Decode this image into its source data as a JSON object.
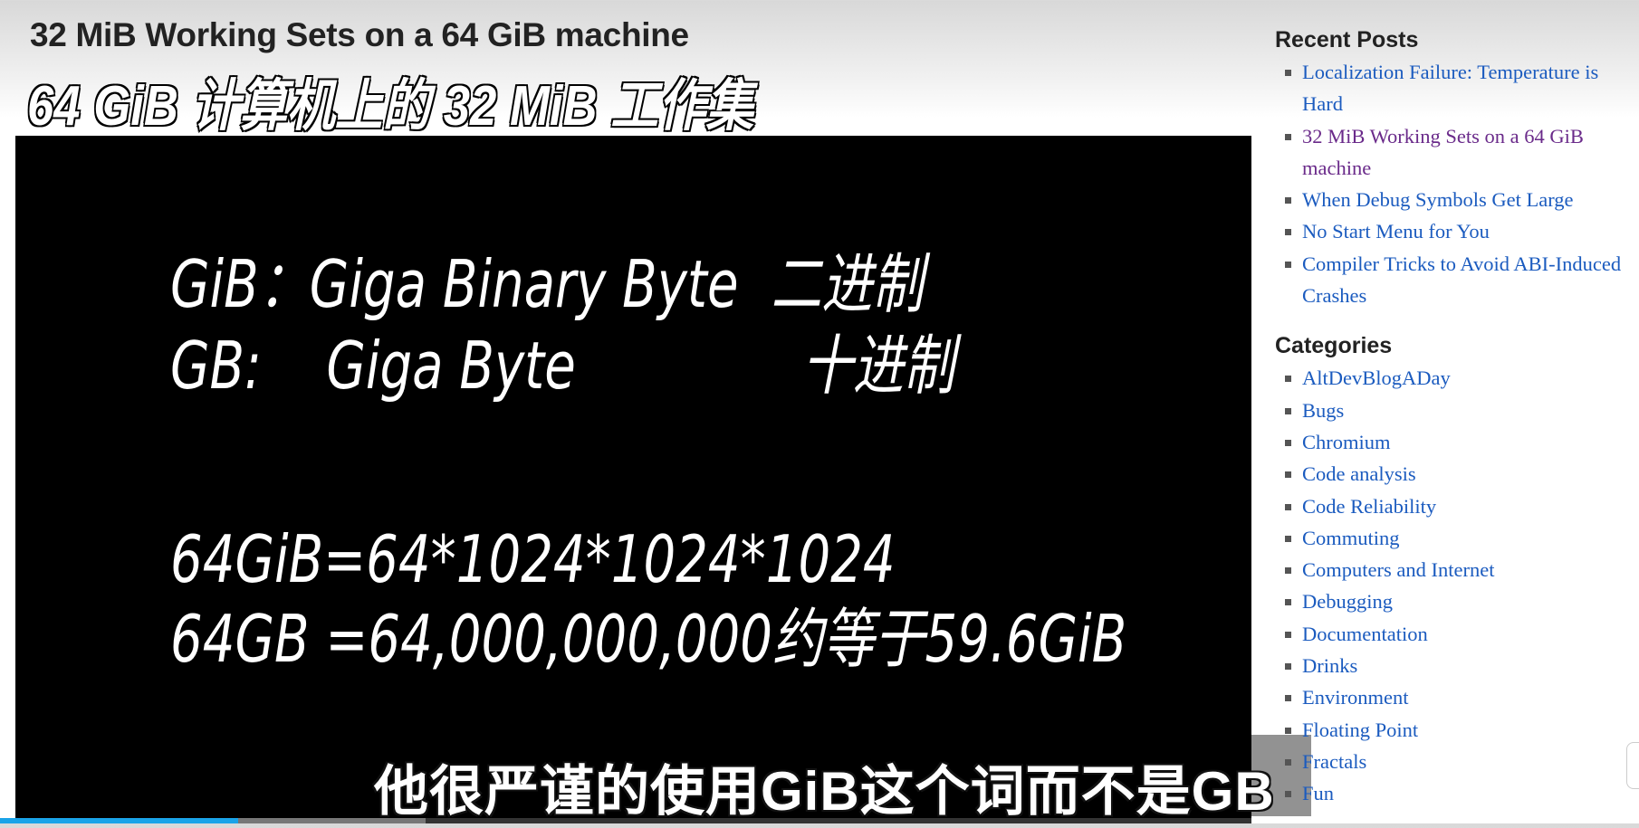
{
  "post": {
    "title": "32 MiB Working Sets on a 64 GiB machine"
  },
  "video": {
    "overlay_title": "64 GiB 计算机上的 32 MiB 工作集",
    "slide_lines": [
      "GiB：Giga Binary Byte  二进制",
      "GB:    Giga Byte              十进制",
      "64GiB=64*1024*1024*1024",
      "64GB =64,000,000,000约等于59.6GiB"
    ],
    "caption": "他很严谨的使用GiB这个词而不是GB",
    "progress_played_percent": 19,
    "progress_buffered_percent": 34,
    "accent_color": "#1aa3e8"
  },
  "sidebar": {
    "recent_posts_heading": "Recent Posts",
    "recent_posts": [
      {
        "label": "Localization Failure: Temperature is Hard"
      },
      {
        "label": "32 MiB Working Sets on a 64 GiB machine"
      },
      {
        "label": "When Debug Symbols Get Large"
      },
      {
        "label": "No Start Menu for You"
      },
      {
        "label": "Compiler Tricks to Avoid ABI-Induced Crashes"
      }
    ],
    "categories_heading": "Categories",
    "categories": [
      {
        "label": "AltDevBlogADay"
      },
      {
        "label": "Bugs"
      },
      {
        "label": "Chromium"
      },
      {
        "label": "Code analysis"
      },
      {
        "label": "Code Reliability"
      },
      {
        "label": "Commuting"
      },
      {
        "label": "Computers and Internet"
      },
      {
        "label": "Debugging"
      },
      {
        "label": "Documentation"
      },
      {
        "label": "Drinks"
      },
      {
        "label": "Environment"
      },
      {
        "label": "Floating Point"
      },
      {
        "label": "Fractals"
      },
      {
        "label": "Fun"
      }
    ],
    "link_color": "#1b5bbf",
    "visited_color": "#6a2a8a"
  }
}
